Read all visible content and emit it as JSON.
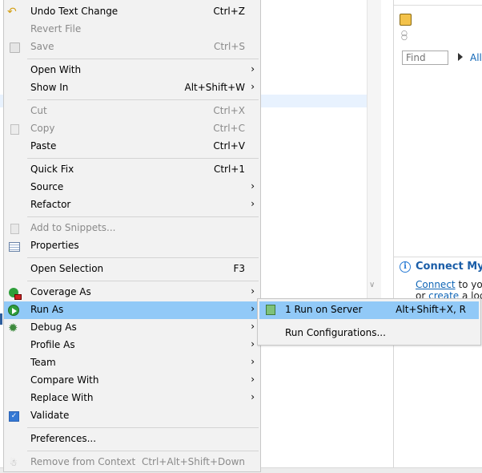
{
  "context_menu": {
    "items": [
      {
        "label": "Undo Text Change",
        "accel": "Ctrl+Z",
        "disabled": false,
        "submenu": false,
        "icon": "undo-icon"
      },
      {
        "label": "Revert File",
        "accel": "",
        "disabled": true,
        "submenu": false,
        "icon": ""
      },
      {
        "label": "Save",
        "accel": "Ctrl+S",
        "disabled": true,
        "submenu": false,
        "icon": "save-icon"
      },
      {
        "label": "Open With",
        "accel": "",
        "disabled": false,
        "submenu": true,
        "icon": ""
      },
      {
        "label": "Show In",
        "accel": "Alt+Shift+W",
        "disabled": false,
        "submenu": true,
        "icon": ""
      },
      {
        "label": "Cut",
        "accel": "Ctrl+X",
        "disabled": true,
        "submenu": false,
        "icon": ""
      },
      {
        "label": "Copy",
        "accel": "Ctrl+C",
        "disabled": true,
        "submenu": false,
        "icon": "copy-icon"
      },
      {
        "label": "Paste",
        "accel": "Ctrl+V",
        "disabled": false,
        "submenu": false,
        "icon": ""
      },
      {
        "label": "Quick Fix",
        "accel": "Ctrl+1",
        "disabled": false,
        "submenu": false,
        "icon": ""
      },
      {
        "label": "Source",
        "accel": "",
        "disabled": false,
        "submenu": true,
        "icon": ""
      },
      {
        "label": "Refactor",
        "accel": "",
        "disabled": false,
        "submenu": true,
        "icon": ""
      },
      {
        "label": "Add to Snippets...",
        "accel": "",
        "disabled": true,
        "submenu": false,
        "icon": "snippets-icon"
      },
      {
        "label": "Properties",
        "accel": "",
        "disabled": false,
        "submenu": false,
        "icon": "properties-icon"
      },
      {
        "label": "Open Selection",
        "accel": "F3",
        "disabled": false,
        "submenu": false,
        "icon": ""
      },
      {
        "label": "Coverage As",
        "accel": "",
        "disabled": false,
        "submenu": true,
        "icon": "coverage-icon"
      },
      {
        "label": "Run As",
        "accel": "",
        "disabled": false,
        "submenu": true,
        "icon": "run-icon",
        "highlighted": true
      },
      {
        "label": "Debug As",
        "accel": "",
        "disabled": false,
        "submenu": true,
        "icon": "debug-icon"
      },
      {
        "label": "Profile As",
        "accel": "",
        "disabled": false,
        "submenu": true,
        "icon": ""
      },
      {
        "label": "Team",
        "accel": "",
        "disabled": false,
        "submenu": true,
        "icon": ""
      },
      {
        "label": "Compare With",
        "accel": "",
        "disabled": false,
        "submenu": true,
        "icon": ""
      },
      {
        "label": "Replace With",
        "accel": "",
        "disabled": false,
        "submenu": true,
        "icon": ""
      },
      {
        "label": "Validate",
        "accel": "",
        "disabled": false,
        "submenu": false,
        "icon": "checkbox-checked-icon"
      },
      {
        "label": "Preferences...",
        "accel": "",
        "disabled": false,
        "submenu": false,
        "icon": ""
      },
      {
        "label": "Remove from Context",
        "accel": "Ctrl+Alt+Shift+Down",
        "disabled": true,
        "submenu": false,
        "icon": "remove-context-icon"
      }
    ]
  },
  "run_as_submenu": {
    "items": [
      {
        "label": "1 Run on Server",
        "accel": "Alt+Shift+X, R",
        "icon": "server-run-icon",
        "highlighted": true
      },
      {
        "label": "Run Configurations...",
        "accel": "",
        "icon": ""
      }
    ]
  },
  "right_panel": {
    "find_placeholder": "Find",
    "all_link": "All",
    "mylyn_title": "Connect Myly",
    "mylyn_line1_link": "Connect",
    "mylyn_line1_rest": " to you",
    "mylyn_line2_prefix": "or ",
    "mylyn_line2_link": "create",
    "mylyn_line2_rest": " a loca"
  },
  "colors": {
    "menu_bg": "#f2f2f2",
    "highlight": "#91c9f7",
    "link": "#0f65b6"
  }
}
